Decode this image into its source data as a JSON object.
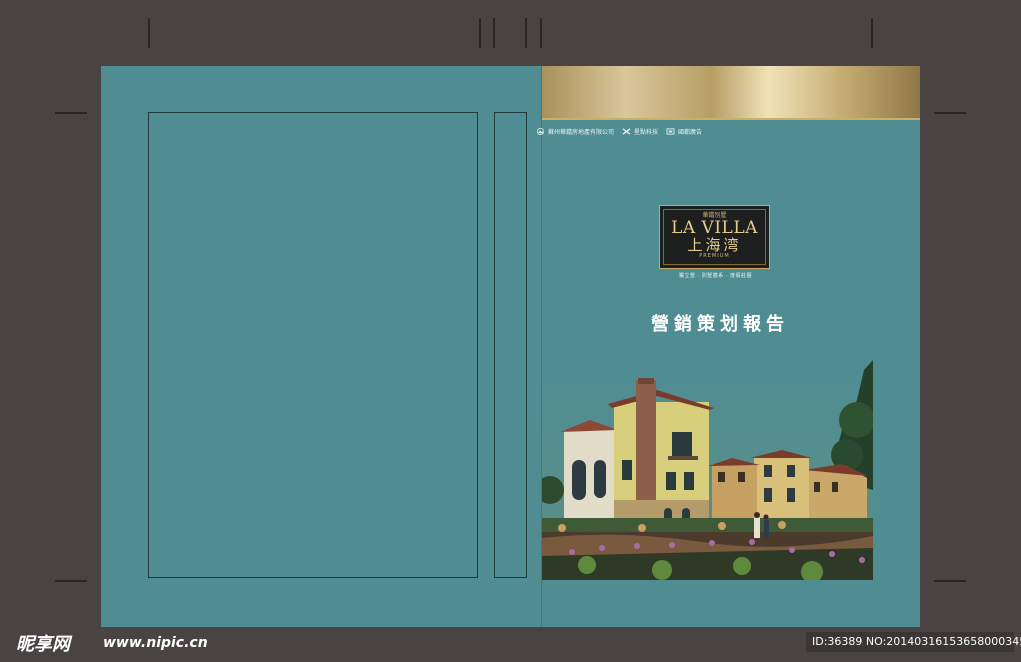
{
  "cover": {
    "developers": [
      {
        "name": "蘇州華鍇房地產有限公司",
        "icon": "mountain-logo-icon"
      },
      {
        "name": "星點科技",
        "icon": "x-logo-icon"
      },
      {
        "name": "國都廣告",
        "icon": "square-logo-icon"
      }
    ],
    "logo": {
      "top_text": "華鍇別墅",
      "brand": "LA VILLA",
      "chinese_name": "上海湾",
      "grade": "PREMIUM"
    },
    "tagline": "獨立墅 · 別墅體系 · 度假莊園",
    "title": "營銷策划報告"
  },
  "watermark": {
    "site_name": "昵享网",
    "url": "www.nipic.cn",
    "id_text": "ID:36389 NO:20140316153658000345"
  },
  "colors": {
    "cover_teal": "#4f8d93",
    "gold": "#c9b06a",
    "background": "#494443"
  }
}
